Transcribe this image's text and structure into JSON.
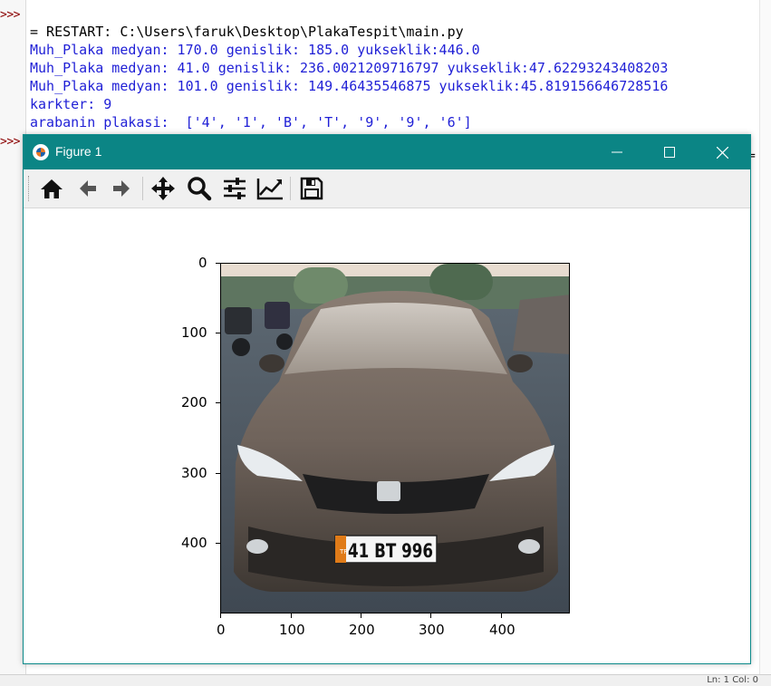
{
  "shell": {
    "cut_line": "                              ",
    "prompts": [
      ">>>",
      ">>>"
    ],
    "lines": [
      {
        "text": "= RESTART: C:\\Users\\faruk\\Desktop\\PlakaTespit\\main.py",
        "color": "black"
      },
      {
        "text": "Muh_Plaka medyan: 170.0 genislik: 185.0 yukseklik:446.0",
        "color": "blue"
      },
      {
        "text": "Muh_Plaka medyan: 41.0 genislik: 236.0021209716797 yukseklik:47.62293243408203",
        "color": "blue"
      },
      {
        "text": "Muh_Plaka medyan: 101.0 genislik: 149.46435546875 yukseklik:45.819156646728516",
        "color": "blue"
      },
      {
        "text": "karkter: 9",
        "color": "blue"
      },
      {
        "text": "arabanin plakasi:  ['4', '1', 'B', 'T', '9', '9', '6']",
        "color": "blue"
      }
    ],
    "status_right": "Ln: 1  Col: 0"
  },
  "figure": {
    "title": "Figure 1",
    "window_buttons": {
      "minimize": "—",
      "maximize": "☐",
      "close": "✕"
    },
    "toolbar_icons": [
      "home-icon",
      "back-arrow-icon",
      "forward-arrow-icon",
      "pan-move-icon",
      "zoom-magnifier-icon",
      "configure-subplots-icon",
      "edit-axis-line-icon",
      "save-floppy-icon"
    ],
    "plate_text": "41 BT 996",
    "plate_country": "TR",
    "axes": {
      "xticks": [
        "0",
        "100",
        "200",
        "300",
        "400"
      ],
      "yticks": [
        "0",
        "100",
        "200",
        "300",
        "400"
      ]
    }
  },
  "colors": {
    "titlebar": "#0b8585",
    "shell_blue": "#1f1fd6",
    "prompt_red": "#8b0000"
  }
}
